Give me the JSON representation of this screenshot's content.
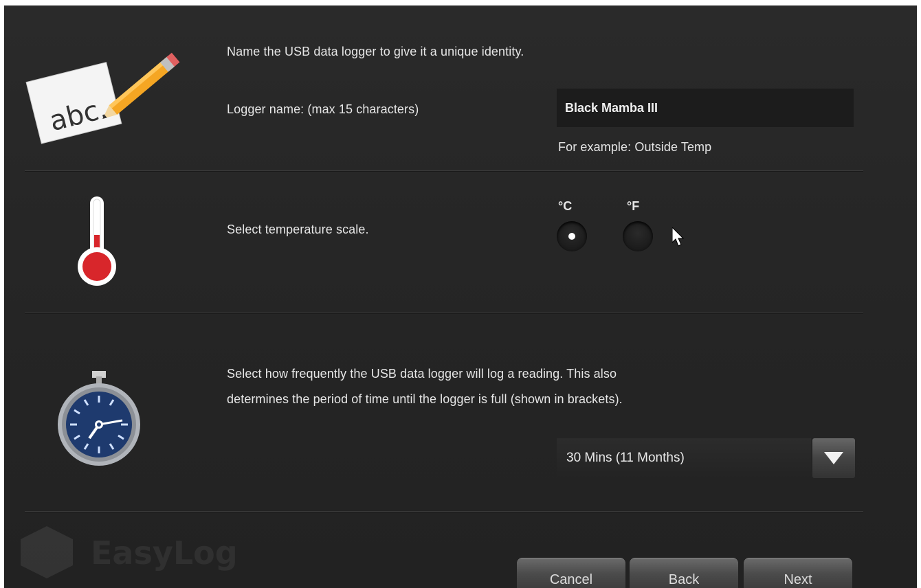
{
  "section_name": {
    "intro": "Name the USB data logger to give it a unique identity.",
    "field_label": "Logger name: (max 15 characters)",
    "field_value": "Black Mamba III",
    "example": "For example: Outside Temp",
    "icon_text": "abc."
  },
  "section_temp": {
    "prompt": "Select temperature scale.",
    "options": [
      {
        "label": "°C",
        "selected": true
      },
      {
        "label": "°F",
        "selected": false
      }
    ]
  },
  "section_rate": {
    "prompt_line1": "Select how frequently the USB data logger will log a reading. This also",
    "prompt_line2": "determines the period of time until the logger is full (shown in brackets).",
    "selected": "30 Mins (11 Months)"
  },
  "footer": {
    "logo_text": "EasyLog",
    "cancel": "Cancel",
    "back": "Back",
    "next": "Next"
  },
  "colors": {
    "background": "#262626",
    "thermometer_red": "#d8262b",
    "pencil_orange": "#f0a020",
    "clock_blue": "#1e3a6e"
  },
  "icons": [
    "pencil-paper-icon",
    "thermometer-icon",
    "stopwatch-icon",
    "mouse-cursor-icon",
    "easylog-logo-icon"
  ]
}
